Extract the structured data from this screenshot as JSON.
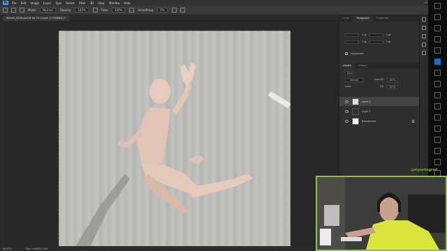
{
  "app": {
    "logo": "Ps"
  },
  "menu": [
    "File",
    "Edit",
    "Image",
    "Layer",
    "Type",
    "Select",
    "Filter",
    "3D",
    "View",
    "Window",
    "Help"
  ],
  "window_controls": [
    "—",
    "□",
    "✕"
  ],
  "options": {
    "mode_label": "Mode:",
    "mode_value": "Normal",
    "opacity_label": "Opacity:",
    "opacity_value": "100%",
    "flow_label": "Flow:",
    "flow_value": "100%",
    "smoothing_label": "Smoothing:",
    "smoothing_value": "0%"
  },
  "document": {
    "tab_title": "Sketch_0026.psd @ 64,7% (Layer 2, RGB/8#) *"
  },
  "status": {
    "zoom": "64,67%",
    "doc_size": "Doc: 5,49M/12,0M"
  },
  "panels": {
    "top_tabs": [
      "Color",
      "Paragraph",
      "Character"
    ],
    "para_values": [
      "0 pt",
      "0 pt",
      "0 pt",
      "0 pt"
    ],
    "hyphenate": "Hyphenate",
    "layer_tabs": [
      "Layers",
      "History"
    ],
    "kind_label": "Kind",
    "blend_mode": "Normal",
    "opacity_label": "Opacity:",
    "opacity_value": "100%",
    "lock_label": "Lock:",
    "fill_label": "Fill:",
    "fill_value": "100%",
    "layers": [
      {
        "name": "Layer 2",
        "selected": true
      },
      {
        "name": "Layer 1",
        "selected": false
      },
      {
        "name": "Background",
        "selected": false
      }
    ]
  },
  "webcam": {
    "tag": "@myurtograd"
  }
}
